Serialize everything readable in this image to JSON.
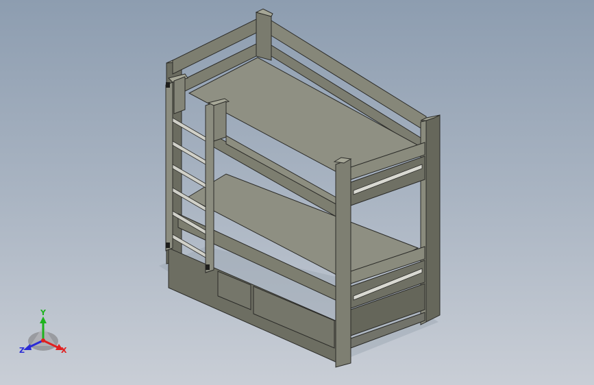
{
  "viewport": {
    "background_top": "#8d9db0",
    "background_bottom": "#c9ced6"
  },
  "model": {
    "name": "bunk-bed",
    "colors": {
      "frame_dark": "#5d5e55",
      "frame_mid": "#7a7b6e",
      "frame_light": "#9a9b8c",
      "mattress": "#8e8f82",
      "ladder_rung": "#cfcfc8",
      "edge": "#2b2b28",
      "shadow": "#9aa2ad"
    }
  },
  "triad": {
    "x_label": "X",
    "y_label": "Y",
    "z_label": "Z",
    "x_color": "#e02020",
    "y_color": "#1db31d",
    "z_color": "#2b2bd6"
  }
}
